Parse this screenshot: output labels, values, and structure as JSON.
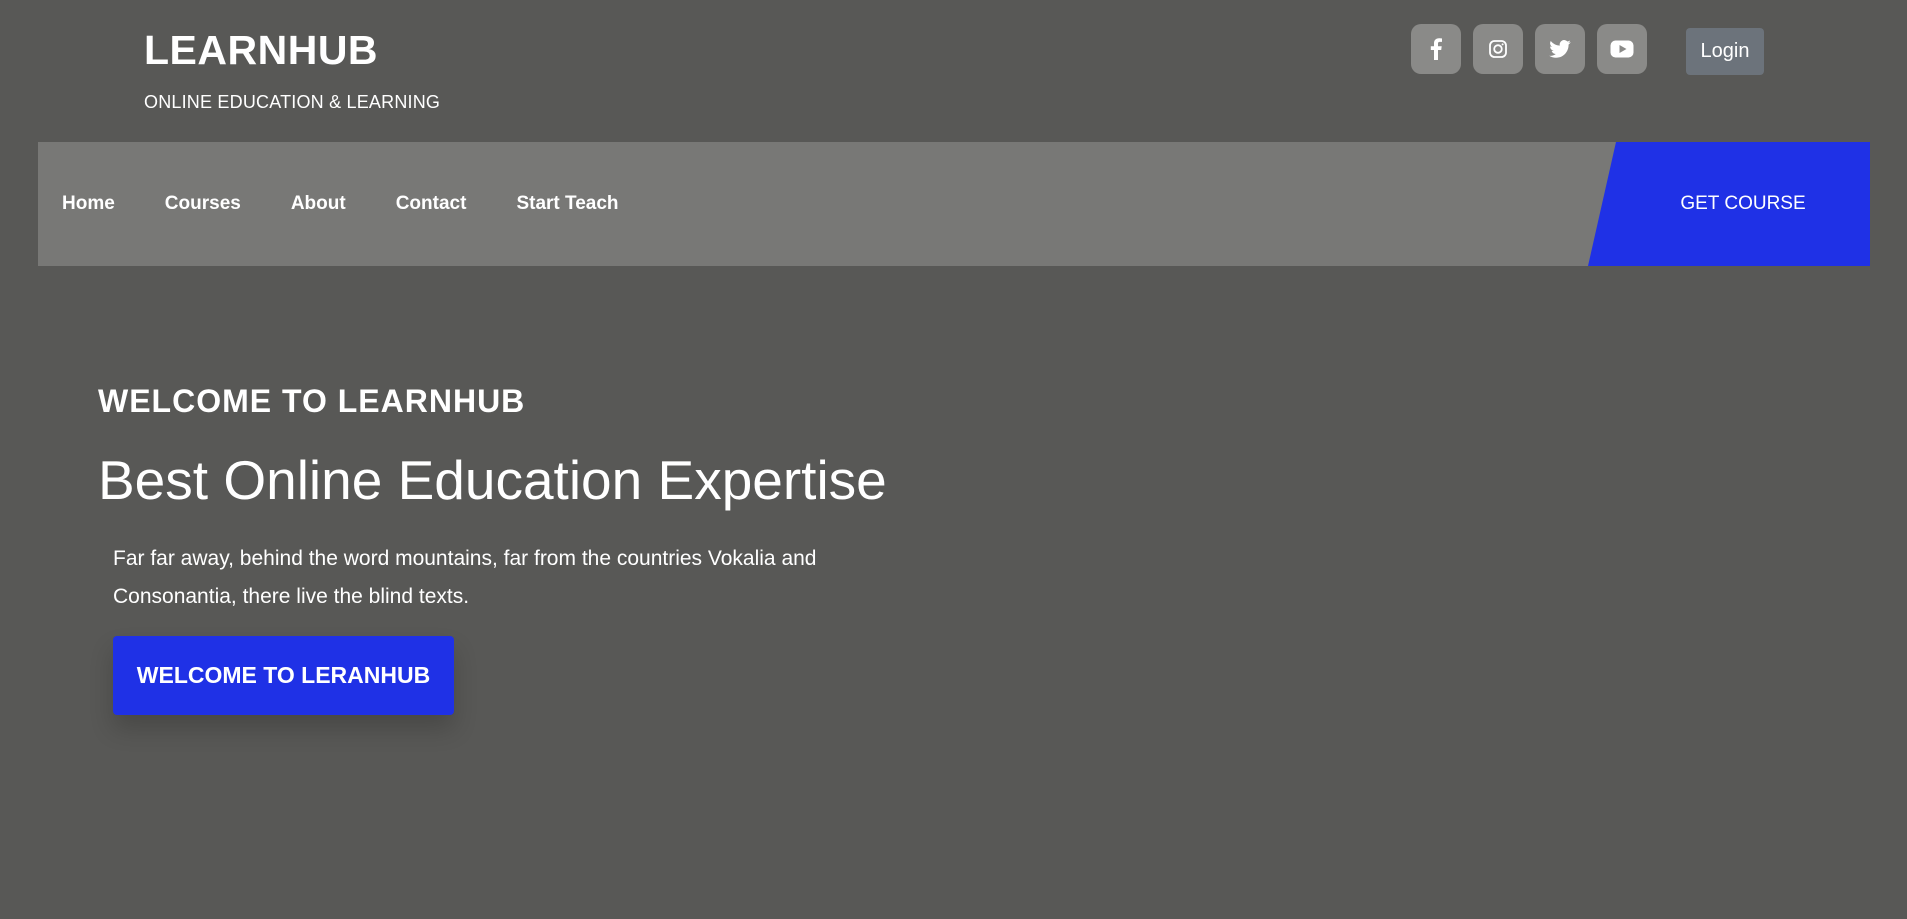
{
  "brand": {
    "title": "LEARNHUB",
    "subtitle": "ONLINE EDUCATION & LEARNING"
  },
  "social": [
    {
      "icon": "facebook-icon"
    },
    {
      "icon": "instagram-icon"
    },
    {
      "icon": "twitter-icon"
    },
    {
      "icon": "youtube-icon"
    }
  ],
  "header": {
    "login_label": "Login"
  },
  "nav": {
    "items": [
      {
        "label": "Home"
      },
      {
        "label": "Courses"
      },
      {
        "label": "About"
      },
      {
        "label": "Contact"
      },
      {
        "label": "Start Teach"
      }
    ],
    "cta_label": "GET COURSE"
  },
  "hero": {
    "kicker": "WELCOME TO LEARNHUB",
    "title": "Best Online Education Expertise",
    "description": "Far far away, behind the word mountains, far from the countries Vokalia and Consonantia, there live the blind texts.",
    "button_label": "WELCOME TO LERANHUB"
  },
  "colors": {
    "background": "#585856",
    "navbar": "#787876",
    "accent": "#1f31e6",
    "social_button": "#8a8a88",
    "login_button": "#6c737b"
  }
}
